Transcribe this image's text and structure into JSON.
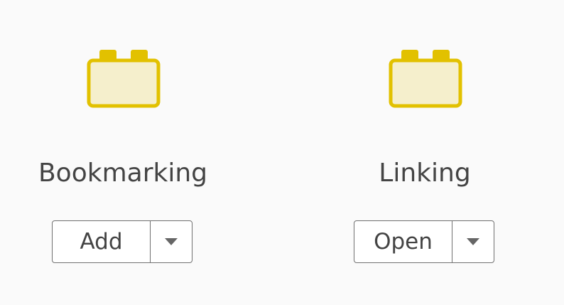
{
  "colors": {
    "icon_stroke": "#e2c100",
    "icon_fill": "#f5efcc",
    "text": "#444444",
    "button_border": "#707070",
    "background": "#fafafa"
  },
  "tools": [
    {
      "label": "Bookmarking",
      "icon": "building-block-icon",
      "button_label": "Add",
      "dropdown_icon": "caret-down-icon"
    },
    {
      "label": "Linking",
      "icon": "building-block-icon",
      "button_label": "Open",
      "dropdown_icon": "caret-down-icon"
    }
  ]
}
